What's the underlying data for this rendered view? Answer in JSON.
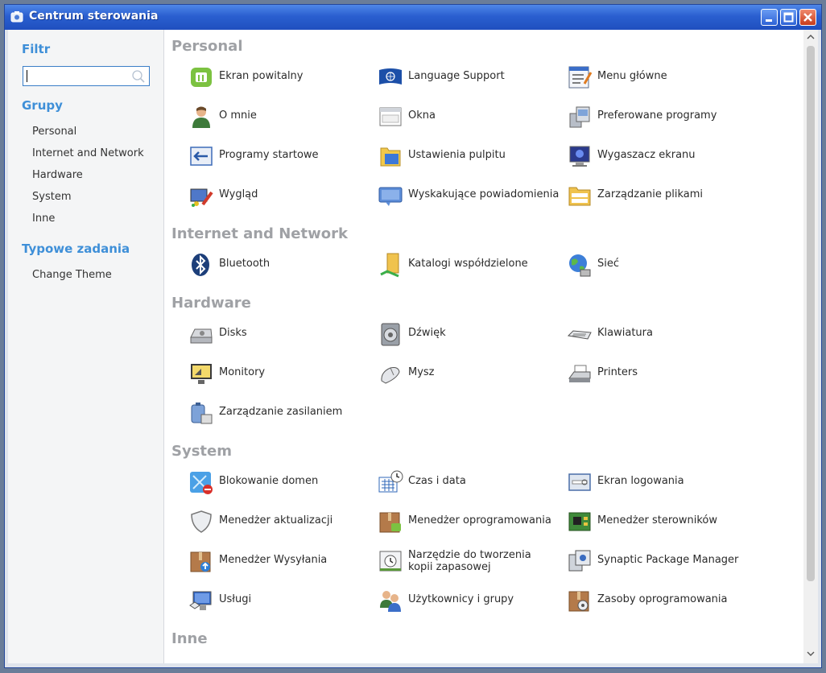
{
  "window": {
    "title": "Centrum sterowania",
    "accent": "#2a5fd0",
    "controls": [
      "minimize-icon",
      "maximize-icon",
      "close-icon"
    ]
  },
  "sidebar": {
    "filter_heading": "Filtr",
    "filter_value": "",
    "groups_heading": "Grupy",
    "groups": [
      "Personal",
      "Internet and Network",
      "Hardware",
      "System",
      "Inne"
    ],
    "tasks_heading": "Typowe zadania",
    "tasks": [
      "Change Theme"
    ]
  },
  "sections": [
    {
      "title": "Personal",
      "items": [
        {
          "label": "Ekran powitalny",
          "icon": "mint-logo-icon"
        },
        {
          "label": "Language Support",
          "icon": "un-flag-icon"
        },
        {
          "label": "Menu główne",
          "icon": "menu-editor-icon"
        },
        {
          "label": "O mnie",
          "icon": "user-icon"
        },
        {
          "label": "Okna",
          "icon": "window-icon"
        },
        {
          "label": "Preferowane programy",
          "icon": "preferred-apps-icon"
        },
        {
          "label": "Programy startowe",
          "icon": "startup-icon"
        },
        {
          "label": "Ustawienia pulpitu",
          "icon": "desktop-folder-icon"
        },
        {
          "label": "Wygaszacz ekranu",
          "icon": "screensaver-icon"
        },
        {
          "label": "Wygląd",
          "icon": "appearance-icon"
        },
        {
          "label": "Wyskakujące powiadomienia",
          "icon": "notification-icon"
        },
        {
          "label": "Zarządzanie plikami",
          "icon": "file-manager-icon"
        }
      ]
    },
    {
      "title": "Internet and Network",
      "items": [
        {
          "label": "Bluetooth",
          "icon": "bluetooth-icon"
        },
        {
          "label": "Katalogi współdzielone",
          "icon": "shared-folder-icon"
        },
        {
          "label": "Sieć",
          "icon": "network-globe-icon"
        }
      ]
    },
    {
      "title": "Hardware",
      "items": [
        {
          "label": "Disks",
          "icon": "disk-icon"
        },
        {
          "label": "Dźwięk",
          "icon": "speaker-icon"
        },
        {
          "label": "Klawiatura",
          "icon": "keyboard-icon"
        },
        {
          "label": "Monitory",
          "icon": "monitor-icon"
        },
        {
          "label": "Mysz",
          "icon": "mouse-icon"
        },
        {
          "label": "Printers",
          "icon": "printer-icon"
        },
        {
          "label": "Zarządzanie zasilaniem",
          "icon": "battery-icon"
        }
      ]
    },
    {
      "title": "System",
      "items": [
        {
          "label": "Blokowanie domen",
          "icon": "domain-block-icon"
        },
        {
          "label": "Czas i data",
          "icon": "calendar-clock-icon"
        },
        {
          "label": "Ekran logowania",
          "icon": "login-screen-icon"
        },
        {
          "label": "Menedżer aktualizacji",
          "icon": "shield-icon"
        },
        {
          "label": "Menedżer oprogramowania",
          "icon": "software-box-icon"
        },
        {
          "label": "Menedżer sterowników",
          "icon": "chip-icon"
        },
        {
          "label": "Menedżer Wysyłania",
          "icon": "upload-box-icon"
        },
        {
          "label": "Narzędzie do tworzenia kopii zapasowej",
          "icon": "backup-icon"
        },
        {
          "label": "Synaptic Package Manager",
          "icon": "synaptic-icon"
        },
        {
          "label": "Usługi",
          "icon": "services-icon"
        },
        {
          "label": "Użytkownicy i grupy",
          "icon": "users-icon"
        },
        {
          "label": "Zasoby oprogramowania",
          "icon": "software-sources-icon"
        }
      ]
    },
    {
      "title": "Inne",
      "items": []
    }
  ]
}
